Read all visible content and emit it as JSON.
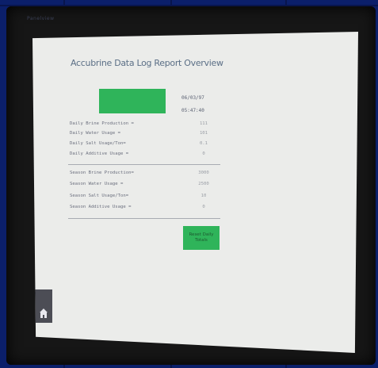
{
  "device": {
    "brand_text": "Panelview"
  },
  "report": {
    "title": "Accubrine Data Log Report Overview",
    "date": "06/03/97",
    "time": "05:47:40"
  },
  "daily_rows": [
    {
      "label": "Daily Brine Production =",
      "value": "111"
    },
    {
      "label": "Daily Water Usage =",
      "value": "101"
    },
    {
      "label": "Daily Salt Usage/Ton=",
      "value": "0.1"
    },
    {
      "label": "Daily Additive Usage =",
      "value": "0"
    }
  ],
  "season_rows": [
    {
      "label": "Season Brine Production=",
      "value": "3000"
    },
    {
      "label": "Season Water Usage =",
      "value": "2500"
    },
    {
      "label": "Season Salt Usage/Ton=",
      "value": "10"
    },
    {
      "label": "Season Additive Usage =",
      "value": "0"
    }
  ],
  "buttons": {
    "reset_label": "Reset Daily Totals"
  },
  "icons": {
    "home": "home-icon"
  },
  "colors": {
    "accent_green": "#2fb45a",
    "screen_bg": "#ebecea",
    "desk_blue": "#0b1f6a"
  }
}
